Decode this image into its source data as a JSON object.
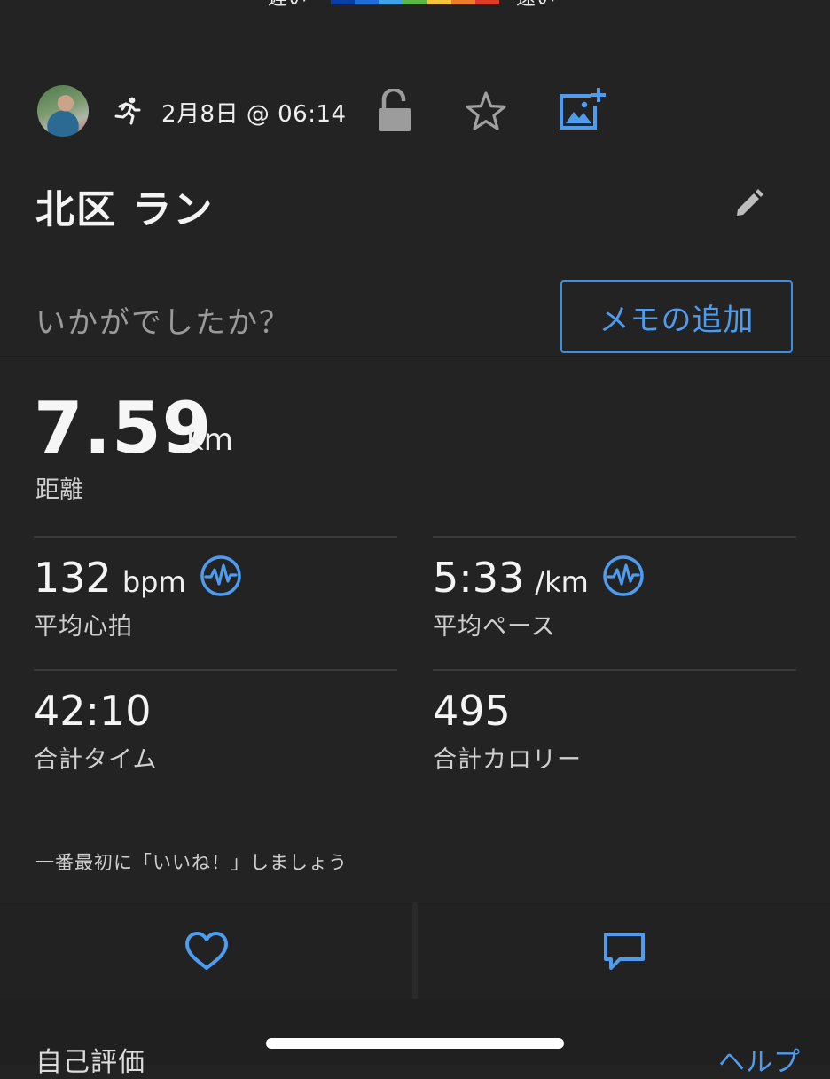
{
  "legend": {
    "slow_label": "遅い",
    "fast_label": "速い",
    "colors": [
      "#0a3fa8",
      "#1f6fd8",
      "#3ea3e8",
      "#5fb648",
      "#f2c53a",
      "#f07d2a",
      "#e03c2c"
    ]
  },
  "header": {
    "date": "2月8日 @ 06:14",
    "activity_icon": "running-icon",
    "privacy_icon": "unlock-icon",
    "favorite_icon": "star-outline-icon",
    "add_photo_icon": "add-photo-icon"
  },
  "activity": {
    "title": "北区 ラン",
    "edit_icon": "pencil-icon"
  },
  "feedback": {
    "question": "いかがでしたか？",
    "memo_button": "メモの追加"
  },
  "distance": {
    "value": "7.59",
    "unit": "km",
    "label": "距離"
  },
  "stats": {
    "heart_rate": {
      "value": "132",
      "unit": "bpm",
      "label": "平均心拍",
      "icon": "heart-rate-icon"
    },
    "pace": {
      "value": "5:33",
      "unit": "/km",
      "label": "平均ペース",
      "icon": "heart-rate-icon"
    },
    "time": {
      "value": "42:10",
      "label": "合計タイム"
    },
    "calories": {
      "value": "495",
      "label": "合計カロリー"
    }
  },
  "social": {
    "like_prompt": "一番最初に「いいね！」しましょう",
    "like_icon": "heart-outline-icon",
    "comment_icon": "comment-icon"
  },
  "footer": {
    "self_evaluation": "自己評価",
    "help": "ヘルプ"
  },
  "colors": {
    "background": "#232323",
    "accent_blue": "#4d9cf0",
    "muted_text": "#9a9a9a"
  }
}
